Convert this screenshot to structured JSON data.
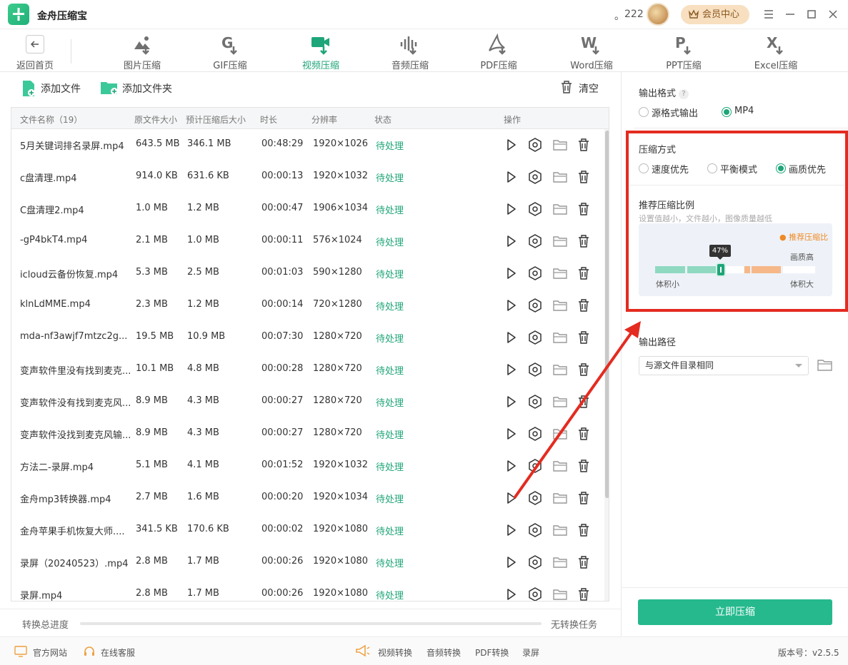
{
  "app": {
    "title": "金舟压缩宝",
    "user_dot": "。",
    "user_name": "222",
    "vip_label": "会员中心"
  },
  "toolbar": {
    "back_label": "返回首页",
    "tools": [
      {
        "label": "图片压缩",
        "icon": "image-compress-icon"
      },
      {
        "label": "GIF压缩",
        "icon": "gif-compress-icon"
      },
      {
        "label": "视频压缩",
        "icon": "video-compress-icon",
        "active": true
      },
      {
        "label": "音频压缩",
        "icon": "audio-compress-icon"
      },
      {
        "label": "PDF压缩",
        "icon": "pdf-compress-icon"
      },
      {
        "label": "Word压缩",
        "icon": "word-compress-icon"
      },
      {
        "label": "PPT压缩",
        "icon": "ppt-compress-icon"
      },
      {
        "label": "Excel压缩",
        "icon": "excel-compress-icon"
      }
    ]
  },
  "file_actions": {
    "add_file": "添加文件",
    "add_folder": "添加文件夹",
    "clear": "清空"
  },
  "table": {
    "headers": {
      "name": "文件名称（19）",
      "original_size": "原文件大小",
      "estimated_size": "预计压缩后大小",
      "duration": "时长",
      "resolution": "分辨率",
      "status": "状态",
      "actions": "操作"
    },
    "rows": [
      {
        "name": "5月关键词排名录屏.mp4",
        "orig": "643.5 MB",
        "est": "346.1 MB",
        "dur": "00:48:29",
        "res": "1920×1026",
        "status": "待处理"
      },
      {
        "name": "c盘清理.mp4",
        "orig": "914.0 KB",
        "est": "631.6 KB",
        "dur": "00:00:13",
        "res": "1920×1032",
        "status": "待处理"
      },
      {
        "name": "C盘清理2.mp4",
        "orig": "1.0 MB",
        "est": "1.2 MB",
        "dur": "00:00:47",
        "res": "1906×1034",
        "status": "待处理"
      },
      {
        "name": "-gP4bkT4.mp4",
        "orig": "2.1 MB",
        "est": "1.0 MB",
        "dur": "00:00:11",
        "res": "576×1024",
        "status": "待处理"
      },
      {
        "name": "icloud云备份恢复.mp4",
        "orig": "5.3 MB",
        "est": "2.5 MB",
        "dur": "00:01:03",
        "res": "590×1280",
        "status": "待处理"
      },
      {
        "name": "klnLdMME.mp4",
        "orig": "2.3 MB",
        "est": "1.2 MB",
        "dur": "00:00:14",
        "res": "720×1280",
        "status": "待处理"
      },
      {
        "name": "mda-nf3awjf7mtzc2g...",
        "orig": "19.5 MB",
        "est": "10.9 MB",
        "dur": "00:07:30",
        "res": "1280×720",
        "status": "待处理"
      },
      {
        "name": "变声软件里没有找到麦克...",
        "orig": "10.1 MB",
        "est": "4.8 MB",
        "dur": "00:00:28",
        "res": "1280×720",
        "status": "待处理"
      },
      {
        "name": "变声软件没有找到麦克风...",
        "orig": "8.9 MB",
        "est": "4.3 MB",
        "dur": "00:00:27",
        "res": "1280×720",
        "status": "待处理"
      },
      {
        "name": "变声软件没找到麦克风输...",
        "orig": "8.9 MB",
        "est": "4.3 MB",
        "dur": "00:00:27",
        "res": "1280×720",
        "status": "待处理"
      },
      {
        "name": "方法二-录屏.mp4",
        "orig": "5.1 MB",
        "est": "4.1 MB",
        "dur": "00:01:52",
        "res": "1920×1032",
        "status": "待处理"
      },
      {
        "name": "金舟mp3转换器.mp4",
        "orig": "2.7 MB",
        "est": "1.6 MB",
        "dur": "00:00:20",
        "res": "1920×1034",
        "status": "待处理"
      },
      {
        "name": "金舟苹果手机恢复大师....",
        "orig": "341.5 KB",
        "est": "170.6 KB",
        "dur": "00:00:02",
        "res": "1920×1080",
        "status": "待处理"
      },
      {
        "name": "录屏（20240523）.mp4",
        "orig": "2.8 MB",
        "est": "1.7 MB",
        "dur": "00:00:26",
        "res": "1920×1080",
        "status": "待处理"
      },
      {
        "name": "录屏.mp4",
        "orig": "2.8 MB",
        "est": "1.7 MB",
        "dur": "00:00:26",
        "res": "1920×1080",
        "status": "待处理"
      }
    ]
  },
  "progress": {
    "label": "转换总进度",
    "status": "无转换任务",
    "value": 0
  },
  "settings": {
    "output_format": {
      "title": "输出格式",
      "help": "?",
      "options": [
        "源格式输出",
        "MP4"
      ],
      "selected": "MP4"
    },
    "compress_mode": {
      "title": "压缩方式",
      "options": [
        "速度优先",
        "平衡模式",
        "画质优先"
      ],
      "selected": "画质优先"
    },
    "ratio": {
      "title": "推荐压缩比例",
      "hint": "设置值越小，文件越小，图像质量越低",
      "recommended_label": "推荐压缩比",
      "value_label": "47%",
      "value": 0.47,
      "left_label": "体积小",
      "right_label": "体积大",
      "top_right_label": "画质高"
    },
    "output_path": {
      "title": "输出路径",
      "selected": "与源文件目录相同"
    },
    "start_button": "立即压缩"
  },
  "footer": {
    "website": "官方网站",
    "support": "在线客服",
    "links": [
      "视频转换",
      "音频转换",
      "PDF转换",
      "录屏"
    ],
    "version": "版本号：v2.5.5"
  },
  "colors": {
    "accent": "#1fa57a",
    "button": "#25b98d",
    "highlight_box": "#e42b20",
    "recommend": "#f08a24"
  }
}
